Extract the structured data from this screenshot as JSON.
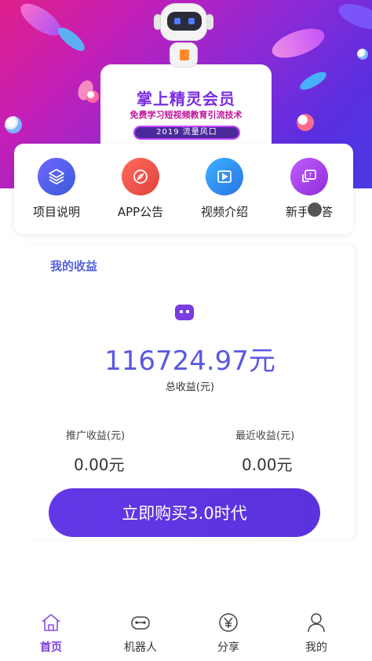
{
  "banner": {
    "title": "掌上精灵会员",
    "subtitle": "免费学习短视频教育引流技术",
    "tag": "2019 流量风口"
  },
  "nav": {
    "items": [
      {
        "label": "项目说明",
        "icon": "layers-icon"
      },
      {
        "label": "APP公告",
        "icon": "compass-icon"
      },
      {
        "label": "视频介绍",
        "icon": "video-icon"
      },
      {
        "label": "新手问答",
        "icon": "question-chat-icon"
      }
    ]
  },
  "earnings": {
    "title": "我的收益",
    "total": "116724.97元",
    "total_label": "总收益(元)",
    "promo_label": "推广收益(元)",
    "promo_value": "0.00元",
    "recent_label": "最近收益(元)",
    "recent_value": "0.00元",
    "buy_button": "立即购买3.0时代"
  },
  "tabbar": {
    "items": [
      {
        "label": "首页",
        "icon": "home-icon",
        "active": true
      },
      {
        "label": "机器人",
        "icon": "robot-icon",
        "active": false
      },
      {
        "label": "分享",
        "icon": "yen-icon",
        "active": false
      },
      {
        "label": "我的",
        "icon": "user-icon",
        "active": false
      }
    ]
  },
  "colors": {
    "accent": "#5b58e0",
    "button": "#6238e6",
    "active_tab": "#7a3be0"
  }
}
